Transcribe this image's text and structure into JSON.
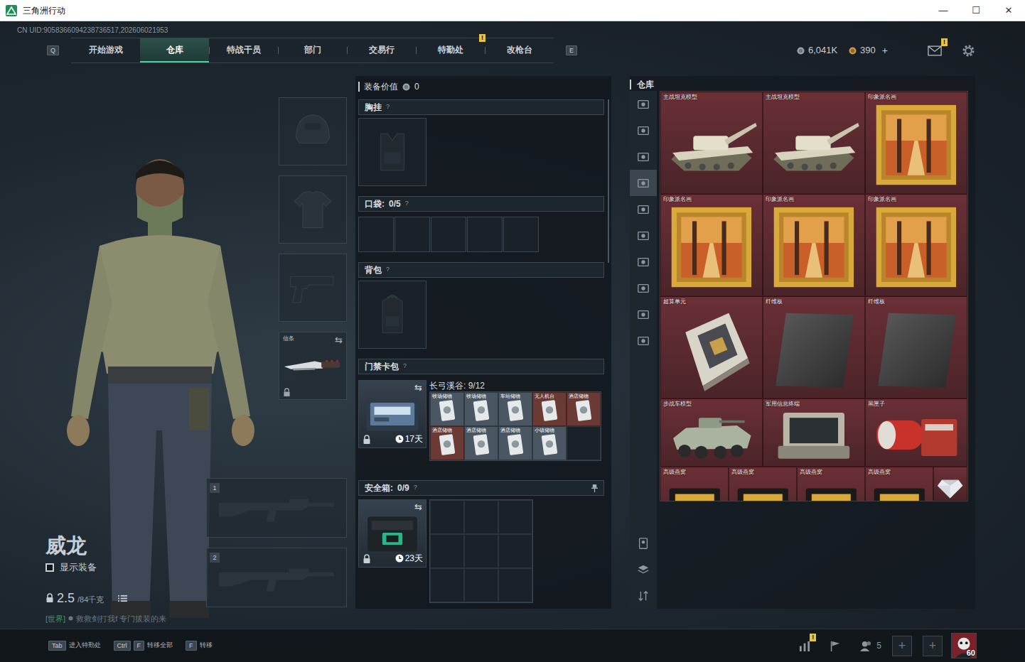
{
  "window": {
    "title": "三角洲行动",
    "controls": [
      "—",
      "☐",
      "✕"
    ]
  },
  "uid": "CN UID:9058366094238736517,202606021953",
  "nav": {
    "prev_key": "Q",
    "next_key": "E",
    "tabs": [
      {
        "label": "开始游戏",
        "selected": false
      },
      {
        "label": "仓库",
        "selected": true
      },
      {
        "label": "特战干员",
        "selected": false
      },
      {
        "label": "部门",
        "selected": false
      },
      {
        "label": "交易行",
        "selected": false
      },
      {
        "label": "特勤处",
        "selected": false,
        "badge": "!"
      },
      {
        "label": "改枪台",
        "selected": false
      }
    ]
  },
  "currency": [
    {
      "kind": "coin",
      "amount": "6,041K"
    },
    {
      "kind": "ticket",
      "amount": "390",
      "add": "+"
    }
  ],
  "mail": {
    "badge": "!"
  },
  "character": {
    "name": "威龙",
    "show_equipment": {
      "label": "显示装备",
      "checked": false
    },
    "weight": "2.5",
    "weight_max": "/84千克",
    "chat": {
      "channel": "[世界]",
      "message": "救救剑打我f 专门拔装的来"
    }
  },
  "gear_slots": [
    {
      "kind": "helmet"
    },
    {
      "kind": "armor"
    },
    {
      "kind": "pistol"
    },
    {
      "kind": "melee",
      "label": "信条",
      "swap": "⇆",
      "locked": true
    }
  ],
  "weapon_slots": [
    {
      "number": "1"
    },
    {
      "number": "2"
    }
  ],
  "loadout": {
    "value_label": "装备价值",
    "value": "0",
    "chest": {
      "label": "胸挂",
      "help": "?"
    },
    "pockets": {
      "label": "口袋:",
      "count": "0/5",
      "help": "?",
      "slots": [
        {
          "filled": false
        },
        {
          "filled": false
        },
        {
          "filled": false
        },
        {
          "filled": false
        },
        {
          "filled": false
        }
      ]
    },
    "backpack": {
      "label": "背包",
      "help": "?"
    },
    "keycards": {
      "label": "门禁卡包",
      "help": "?",
      "case": {
        "swap": "⇆",
        "locked": true,
        "timer": "17天"
      },
      "map": "长弓溪谷: 9/12",
      "cards": [
        {
          "label": "牧场储物",
          "color": "#4b5663"
        },
        {
          "label": "牧场储物",
          "color": "#4b5663"
        },
        {
          "label": "车站储物",
          "color": "#4b5663"
        },
        {
          "label": "无人机台",
          "color": "#6b3a34"
        },
        {
          "label": "酒店储物",
          "color": "#6b3a34"
        },
        {
          "label": "酒店储物",
          "color": "#6b3a34"
        },
        {
          "label": "酒店储物",
          "color": "#4b5663"
        },
        {
          "label": "酒店储物",
          "color": "#4b5663"
        },
        {
          "label": "小镇储物",
          "color": "#4b5663"
        }
      ],
      "empty_slots": 1
    },
    "safe": {
      "label": "安全箱:",
      "count": "0/9",
      "help": "?",
      "box": {
        "swap": "⇆",
        "locked": true,
        "timer": "23天"
      },
      "cells": [
        {
          "filled": false
        },
        {
          "filled": false
        },
        {
          "filled": false
        },
        {
          "filled": false
        },
        {
          "filled": false
        },
        {
          "filled": false
        },
        {
          "filled": false
        },
        {
          "filled": false
        },
        {
          "filled": false
        }
      ]
    }
  },
  "stash": {
    "title": "仓库",
    "tabs": [
      {
        "selected": false
      },
      {
        "selected": false
      },
      {
        "selected": false
      },
      {
        "selected": true
      },
      {
        "selected": false
      },
      {
        "selected": false
      },
      {
        "selected": false
      },
      {
        "selected": false
      },
      {
        "selected": false
      },
      {
        "selected": false
      }
    ],
    "tools": [
      {
        "kind": "sort"
      },
      {
        "kind": "layers"
      },
      {
        "kind": "arrange"
      }
    ],
    "items": [
      {
        "label": "主战坦克模型",
        "kind": "tank"
      },
      {
        "label": "主战坦克模型",
        "kind": "tank"
      },
      {
        "label": "印象派名画",
        "kind": "painting"
      },
      {
        "label": "印象派名画",
        "kind": "painting"
      },
      {
        "label": "印象派名画",
        "kind": "painting"
      },
      {
        "label": "印象派名画",
        "kind": "painting"
      },
      {
        "label": "超算单元",
        "kind": "compute"
      },
      {
        "label": "纤维板",
        "kind": "board"
      },
      {
        "label": "纤维板",
        "kind": "board"
      },
      {
        "label": "步战车模型",
        "kind": "ifv"
      },
      {
        "label": "军用信息终端",
        "kind": "terminal"
      },
      {
        "label": "黑匣子",
        "kind": "blackbox"
      },
      {
        "label": "高级燕窝",
        "kind": "gold"
      },
      {
        "label": "高级燕窝",
        "kind": "gold"
      },
      {
        "label": "高级燕窝",
        "kind": "gold"
      },
      {
        "label": "高级燕窝",
        "kind": "gold"
      },
      {
        "label": "",
        "kind": "diamond"
      }
    ]
  },
  "hints": [
    {
      "keys": [
        "Tab"
      ],
      "label": "进入特勤处"
    },
    {
      "keys": [
        "Ctrl",
        "F"
      ],
      "label": "转移全部"
    },
    {
      "keys": [
        "F"
      ],
      "label": "转移"
    }
  ],
  "social": {
    "stats_badge": "!",
    "friends": "5",
    "slots": [
      "+",
      "+"
    ],
    "level": "60"
  }
}
